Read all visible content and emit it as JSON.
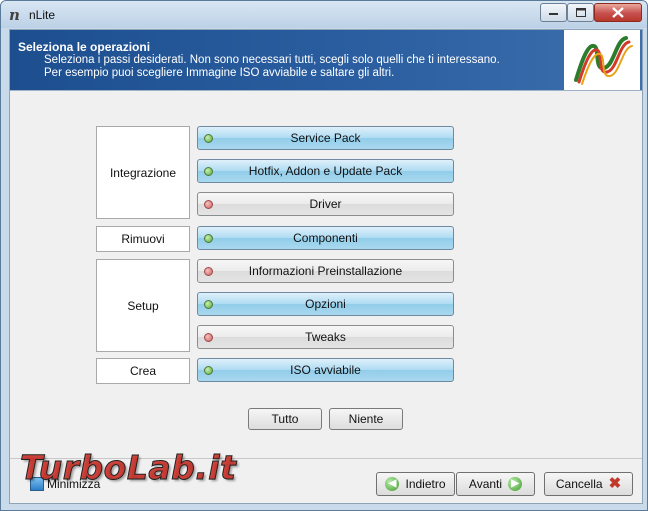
{
  "window": {
    "title": "nLite",
    "icon": "nlite-n-icon"
  },
  "header": {
    "title": "Seleziona le operazioni",
    "description": "Seleziona i passi desiderati. Non sono necessari tutti, scegli solo quelli che ti interessano. Per esempio puoi scegliere Immagine ISO avviabile e saltare gli altri."
  },
  "sections": [
    {
      "label": "Integrazione"
    },
    {
      "label": "Rimuovi"
    },
    {
      "label": "Setup"
    },
    {
      "label": "Crea"
    }
  ],
  "operations": [
    {
      "label": "Service Pack",
      "selected": true
    },
    {
      "label": "Hotfix, Addon e Update Pack",
      "selected": true
    },
    {
      "label": "Driver",
      "selected": false
    },
    {
      "label": "Componenti",
      "selected": true
    },
    {
      "label": "Informazioni Preinstallazione",
      "selected": false
    },
    {
      "label": "Opzioni",
      "selected": true
    },
    {
      "label": "Tweaks",
      "selected": false
    },
    {
      "label": "ISO avviabile",
      "selected": true
    }
  ],
  "select_all_label": "Tutto",
  "select_none_label": "Niente",
  "footer": {
    "minimize_label": "Minimizza",
    "back_label": "Indietro",
    "next_label": "Avanti",
    "cancel_label": "Cancella"
  },
  "watermark": "TurboLab.it",
  "colors": {
    "header_bg": "#1d4f8f",
    "selected_btn": "#aedbf3",
    "green_dot": "#58a83a",
    "red_dot": "#d06060",
    "close_red": "#c75050"
  }
}
